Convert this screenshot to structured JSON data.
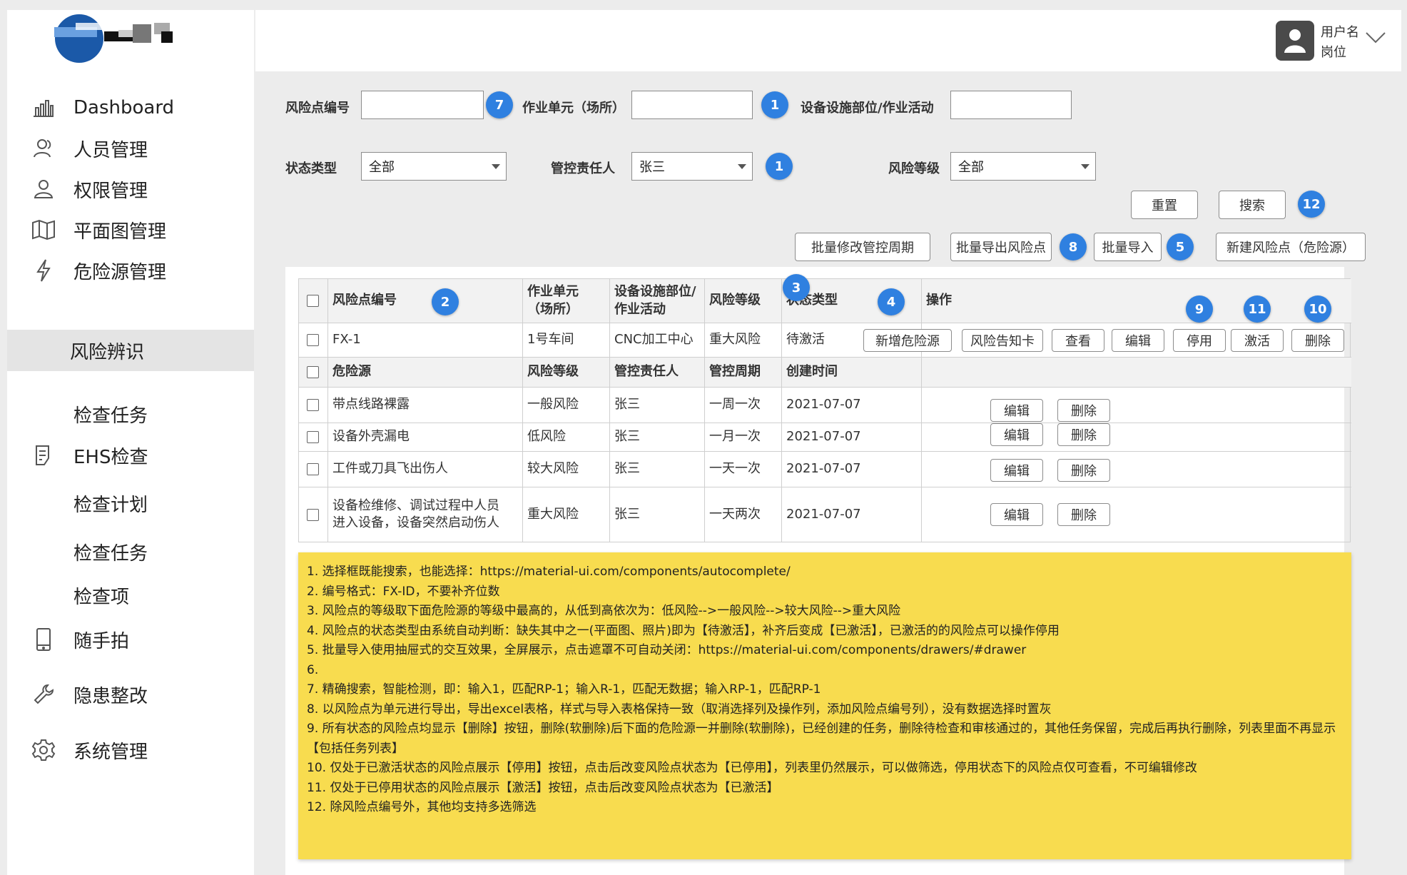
{
  "sidebar": {
    "items": [
      {
        "label": "Dashboard",
        "icon": "bar-chart-icon"
      },
      {
        "label": "人员管理",
        "icon": "people-icon"
      },
      {
        "label": "权限管理",
        "icon": "person-icon"
      },
      {
        "label": "平面图管理",
        "icon": "map-icon"
      },
      {
        "label": "危险源管理",
        "icon": "lightning-icon"
      },
      {
        "label": "风险辨识",
        "icon": ""
      },
      {
        "label": "检查任务",
        "icon": ""
      },
      {
        "label": "EHS检查",
        "icon": "checklist-icon"
      },
      {
        "label": "检查计划",
        "icon": ""
      },
      {
        "label": "检查任务",
        "icon": ""
      },
      {
        "label": "检查项",
        "icon": ""
      },
      {
        "label": "随手拍",
        "icon": "phone-icon"
      },
      {
        "label": "隐患整改",
        "icon": "wrench-icon"
      },
      {
        "label": "系统管理",
        "icon": "gear-icon"
      }
    ]
  },
  "header": {
    "user_name": "用户名",
    "user_role": "岗位"
  },
  "filters": {
    "risk_point_no_label": "风险点编号",
    "work_unit_label": "作业单元（场所）",
    "equipment_label": "设备设施部位/作业活动",
    "status_label": "状态类型",
    "status_value": "全部",
    "owner_label": "管控责任人",
    "owner_value": "张三",
    "risk_level_label": "风险等级",
    "risk_level_value": "全部"
  },
  "buttons": {
    "reset": "重置",
    "search": "搜索",
    "batch_modify": "批量修改管控周期",
    "batch_export": "批量导出风险点",
    "batch_import": "批量导入",
    "new_risk": "新建风险点（危险源）"
  },
  "badges": {
    "b7": "7",
    "b1a": "1",
    "b1b": "1",
    "b12": "12",
    "b8": "8",
    "b5": "5",
    "b2": "2",
    "b3": "3",
    "b4": "4",
    "b9": "9",
    "b11": "11",
    "b10": "10"
  },
  "table": {
    "headers": [
      "风险点编号",
      "作业单元\n（场所）",
      "设备设施部位/\n作业活动",
      "风险等级",
      "状态类型",
      "操作"
    ],
    "row": {
      "id": "FX-1",
      "unit": "1号车间",
      "equipment": "CNC加工中心",
      "level": "重大风险",
      "status": "待激活",
      "actions": [
        "新增危险源",
        "风险告知卡",
        "查看",
        "编辑",
        "停用",
        "激活",
        "删除"
      ]
    },
    "sub_headers": [
      "危险源",
      "风险等级",
      "管控责任人",
      "管控周期",
      "创建时间"
    ],
    "sub_rows": [
      {
        "name": "带点线路裸露",
        "level": "一般风险",
        "owner": "张三",
        "cycle": "一周一次",
        "created": "2021-07-07"
      },
      {
        "name": "设备外壳漏电",
        "level": "低风险",
        "owner": "张三",
        "cycle": "一月一次",
        "created": "2021-07-07"
      },
      {
        "name": "工件或刀具飞出伤人",
        "level": "较大风险",
        "owner": "张三",
        "cycle": "一天一次",
        "created": "2021-07-07"
      },
      {
        "name": "设备检维修、调试过程中人员\n进入设备，设备突然启动伤人",
        "level": "重大风险",
        "owner": "张三",
        "cycle": "一天两次",
        "created": "2021-07-07"
      }
    ],
    "sub_actions": [
      "编辑",
      "删除"
    ]
  },
  "notes": [
    "1. 选择框既能搜索，也能选择：https://material-ui.com/components/autocomplete/",
    "2. 编号格式：FX-ID，不要补齐位数",
    "3. 风险点的等级取下面危险源的等级中最高的，从低到高依次为：低风险-->一般风险-->较大风险-->重大风险",
    "4. 风险点的状态类型由系统自动判断：缺失其中之一(平面图、照片)即为【待激活】，补齐后变成【已激活】，已激活的的风险点可以操作停用",
    "5. 批量导入使用抽屉式的交互效果，全屏展示，点击遮罩不可自动关闭：https://material-ui.com/components/drawers/#drawer",
    "6.",
    "7. 精确搜索，智能检测，即：输入1，匹配RP-1；输入R-1，匹配无数据；输入RP-1，匹配RP-1",
    "8. 以风险点为单元进行导出，导出excel表格，样式与导入表格保持一致（取消选择列及操作列，添加风险点编号列），没有数据选择时置灰",
    "9. 所有状态的风险点均显示【删除】按钮，删除(软删除)后下面的危险源一并删除(软删除)，已经创建的任务，删除待检查和审核通过的，其他任务保留，完成后再执行删除，列表里面不再显示【包括任务列表】",
    "10. 仅处于已激活状态的风险点展示【停用】按钮，点击后改变风险点状态为【已停用】，列表里仍然展示，可以做筛选，停用状态下的风险点仅可查看，不可编辑修改",
    "11. 仅处于已停用状态的风险点展示【激活】按钮，点击后改变风险点状态为【已激活】",
    "12. 除风险点编号外，其他均支持多选筛选"
  ],
  "colors": {
    "badge": "#2f80e0",
    "note_bg": "#f8dc4f",
    "active_nav": "#e4e4e4"
  }
}
